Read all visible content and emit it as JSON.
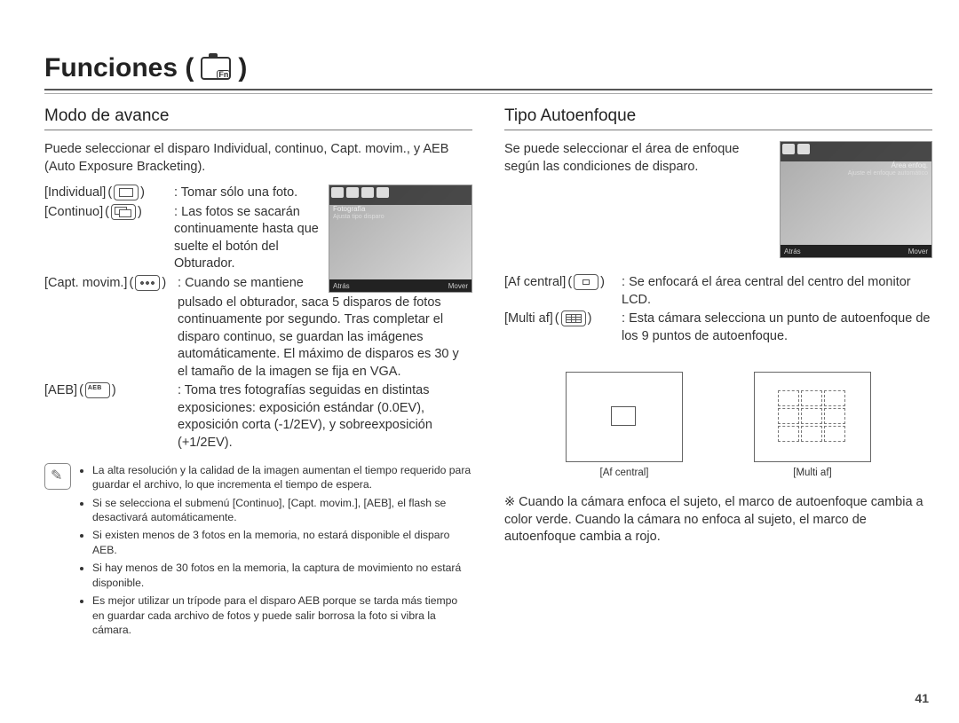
{
  "page_title_prefix": "Funciones (",
  "page_title_suffix": " )",
  "page_number": "41",
  "left": {
    "heading": "Modo de avance",
    "intro": "Puede seleccionar el disparo Individual, continuo, Capt. movim., y AEB (Auto Exposure Bracketing).",
    "lcd": {
      "topline": "Fotografía",
      "subline": "Ajusta tipo disparo",
      "back": "Atrás",
      "move": "Mover"
    },
    "items": [
      {
        "label": "[Individual]",
        "icon": "single",
        "desc": "Tomar sólo una foto."
      },
      {
        "label": "[Continuo]",
        "icon": "cont",
        "desc": "Las fotos se sacarán continuamente hasta que suelte el botón del Obturador."
      },
      {
        "label": "[Capt. movim.]",
        "icon": "mot",
        "desc_short": "Cuando se mantiene",
        "desc_rest": "pulsado el obturador, saca 5 disparos de fotos continuamente por segundo. Tras completar el disparo continuo, se guardan las imágenes automáticamente. El máximo de disparos es 30 y el tamaño de la imagen se fija en VGA."
      },
      {
        "label": "[AEB]",
        "icon": "aeb",
        "desc": "Toma tres fotografías seguidas en distintas exposiciones: exposición estándar (0.0EV), exposición corta (-1/2EV), y sobreexposición (+1/2EV)."
      }
    ],
    "notes": [
      "La alta resolución y la calidad de la imagen aumentan el tiempo requerido para guardar el archivo, lo que incrementa el tiempo de espera.",
      "Si se selecciona el submenú [Continuo], [Capt. movim.], [AEB], el flash se desactivará automáticamente.",
      "Si existen menos de 3 fotos en la memoria, no estará disponible el disparo AEB.",
      "Si hay menos de 30 fotos en la memoria, la captura de movimiento no estará disponible.",
      "Es mejor utilizar un trípode para el disparo AEB porque se tarda más tiempo en guardar cada archivo de fotos y puede salir borrosa la foto si vibra la cámara."
    ]
  },
  "right": {
    "heading": "Tipo Autoenfoque",
    "intro": "Se puede seleccionar el área de enfoque según las condiciones de disparo.",
    "lcd": {
      "topline": "Área enfoq.",
      "subline": "Ajuste el enfoque automático",
      "back": "Atrás",
      "move": "Mover"
    },
    "items": [
      {
        "label": "[Af central]",
        "icon": "centerbox",
        "desc": "Se enfocará el área central del centro del monitor LCD."
      },
      {
        "label": "[Multi af]",
        "icon": "multibox",
        "desc": "Esta cámara selecciona un punto de autoenfoque de los 9 puntos de autoenfoque."
      }
    ],
    "fig_captions": {
      "center": "[Af central]",
      "multi": "[Multi af]"
    },
    "asterisk": "※ Cuando la cámara enfoca el sujeto, el marco de autoenfoque cambia a color verde. Cuando la cámara no enfoca al sujeto, el marco de autoenfoque cambia a rojo."
  }
}
